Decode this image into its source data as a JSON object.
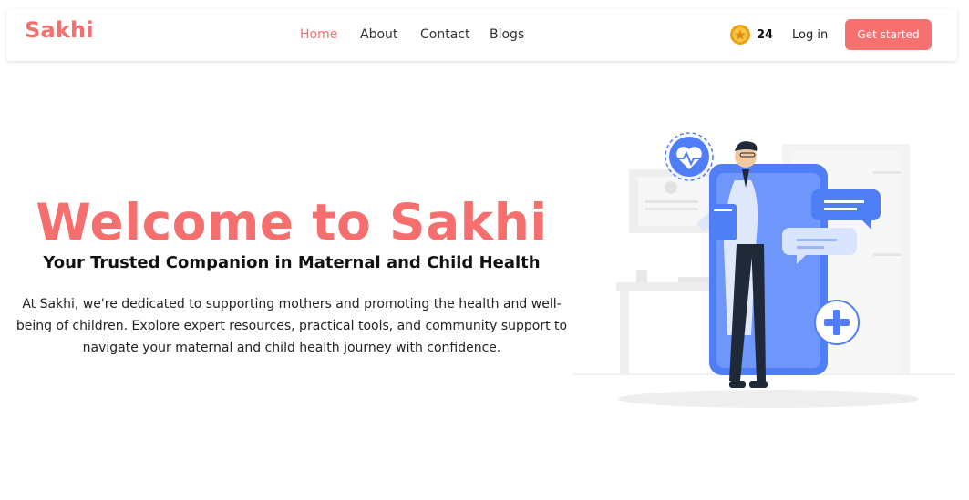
{
  "brand": "Sakhi",
  "nav": {
    "home": "Home",
    "about": "About",
    "contact": "Contact",
    "blogs": "Blogs"
  },
  "coins": {
    "icon": "coin-icon",
    "count": "24"
  },
  "auth": {
    "login": "Log in",
    "get_started": "Get started"
  },
  "hero": {
    "title": "Welcome to Sakhi",
    "subtitle": "Your Trusted Companion in Maternal and Child Health",
    "description": "At Sakhi, we're dedicated to supporting mothers and promoting the health and well-being of children. Explore expert resources, practical tools, and community support to navigate your maternal and child health journey with confidence."
  },
  "colors": {
    "accent": "#f56f6f",
    "button": "#f87171",
    "phone_blue": "#4f7ef7"
  }
}
